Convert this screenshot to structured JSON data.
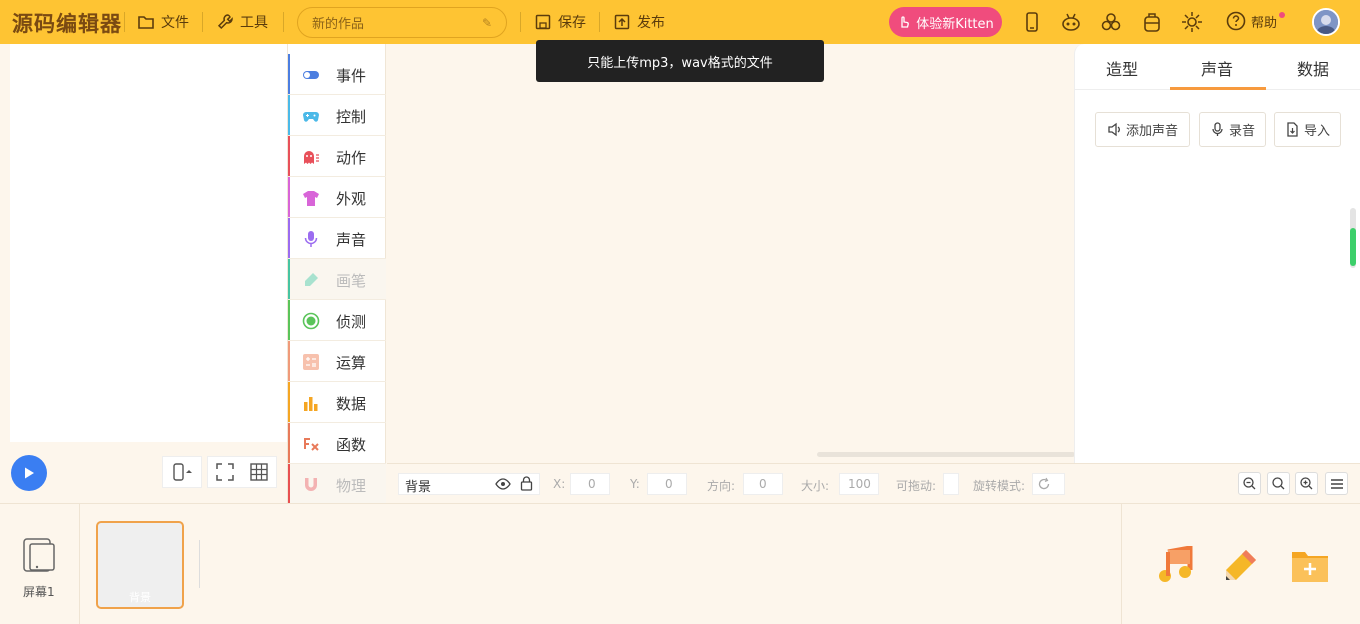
{
  "app": {
    "logo": "源码编辑器"
  },
  "toolbar": {
    "file_label": "文件",
    "tools_label": "工具",
    "title_value": "新的作品",
    "save_label": "保存",
    "publish_label": "发布",
    "kitten_label": "体验新Kitten",
    "help_label": "帮助"
  },
  "toast": {
    "message": "只能上传mp3，wav格式的文件"
  },
  "categories": [
    {
      "label": "事件",
      "color": "#4c7ee0"
    },
    {
      "label": "控制",
      "color": "#4bb9e8"
    },
    {
      "label": "动作",
      "color": "#e8505a"
    },
    {
      "label": "外观",
      "color": "#d865d8"
    },
    {
      "label": "声音",
      "color": "#9b6cf0"
    },
    {
      "label": "画笔",
      "color": "#47c4a2"
    },
    {
      "label": "侦测",
      "color": "#5ac45a"
    },
    {
      "label": "运算",
      "color": "#f09a7a"
    },
    {
      "label": "数据",
      "color": "#f5a623"
    },
    {
      "label": "函数",
      "color": "#e87a5a"
    },
    {
      "label": "物理",
      "color": "#e85050"
    }
  ],
  "right_panel": {
    "tabs": [
      "造型",
      "声音",
      "数据"
    ],
    "active_tab": "声音",
    "add_sound_label": "添加声音",
    "record_label": "录音",
    "import_label": "导入"
  },
  "properties": {
    "sprite_name": "背景",
    "x_label": "X:",
    "x_value": "0",
    "y_label": "Y:",
    "y_value": "0",
    "direction_label": "方向:",
    "direction_value": "0",
    "size_label": "大小:",
    "size_value": "100",
    "draggable_label": "可拖动:",
    "rotation_label": "旋转模式:"
  },
  "bottom": {
    "screen_label": "屏幕1",
    "background_label": "背景"
  },
  "colors": {
    "topbar": "#fec433",
    "accent": "#f79a3e",
    "kitten": "#f04c7d",
    "play": "#3a7ef2"
  }
}
